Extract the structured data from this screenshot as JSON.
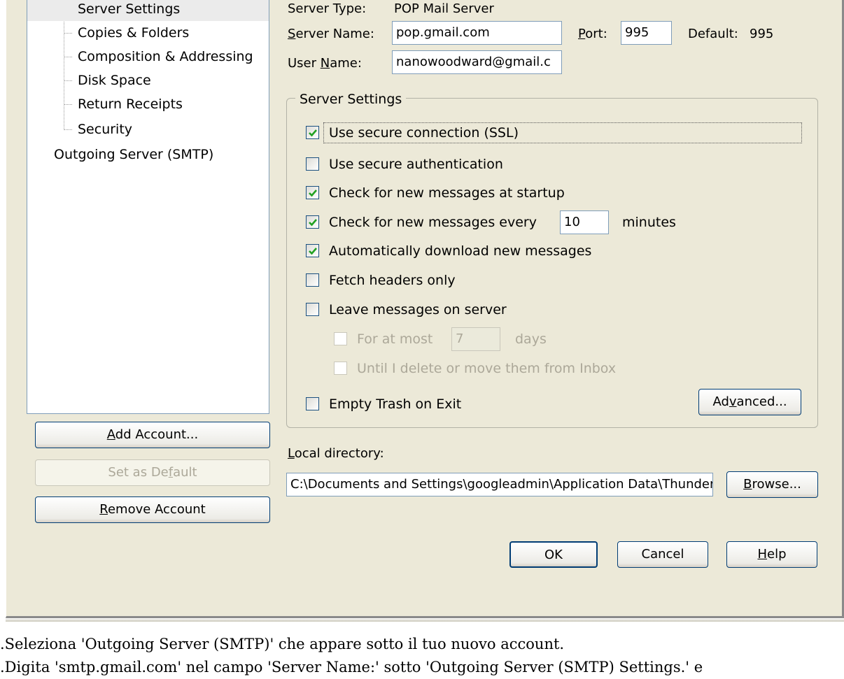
{
  "tree": {
    "items": [
      {
        "label": "Server Settings",
        "selected": true
      },
      {
        "label": "Copies & Folders",
        "selected": false
      },
      {
        "label": "Composition & Addressing",
        "selected": false
      },
      {
        "label": "Disk Space",
        "selected": false
      },
      {
        "label": "Return Receipts",
        "selected": false
      },
      {
        "label": "Security",
        "selected": false
      }
    ],
    "outgoing_label": "Outgoing Server (SMTP)"
  },
  "left_buttons": {
    "add_account": "Add Account...",
    "set_default": "Set as Default",
    "remove_account": "Remove Account"
  },
  "server": {
    "type_label": "Server Type:",
    "type_value": "POP Mail Server",
    "name_label": "Server Name:",
    "name_value": "pop.gmail.com",
    "port_label": "Port:",
    "port_value": "995",
    "default_label": "Default:",
    "default_value": "995",
    "user_label": "User Name:",
    "user_value": "nanowoodward@gmail.c"
  },
  "settings_group": {
    "title": "Server Settings",
    "use_ssl": {
      "label": "Use secure connection (SSL)",
      "checked": true
    },
    "secure_auth": {
      "label": "Use secure authentication",
      "checked": false
    },
    "check_startup": {
      "label": "Check for new messages at startup",
      "checked": true
    },
    "check_every": {
      "label": "Check for new messages every",
      "checked": true,
      "value": "10",
      "unit": "minutes"
    },
    "auto_download": {
      "label": "Automatically download new messages",
      "checked": true
    },
    "headers_only": {
      "label": "Fetch headers only",
      "checked": false
    },
    "leave_on_server": {
      "label": "Leave messages on server",
      "checked": false
    },
    "for_at_most": {
      "label": "For at most",
      "checked": false,
      "value": "7",
      "unit": "days"
    },
    "until_delete": {
      "label": "Until I delete or move them from Inbox",
      "checked": false
    },
    "empty_trash": {
      "label": "Empty Trash on Exit",
      "checked": false
    },
    "advanced_button": "Advanced..."
  },
  "local_dir": {
    "label": "Local directory:",
    "value": "C:\\Documents and Settings\\googleadmin\\Application Data\\Thunderbird",
    "browse_button": "Browse..."
  },
  "footer": {
    "ok": "OK",
    "cancel": "Cancel",
    "help": "Help"
  },
  "instructions": {
    "line1": ".Seleziona 'Outgoing Server (SMTP)' che appare sotto il tuo nuovo account.",
    "line2": ".Digita 'smtp.gmail.com' nel campo 'Server Name:' sotto 'Outgoing Server (SMTP) Settings.' e"
  },
  "colors": {
    "dialog_bg": "#ece9d8",
    "check_green": "#21a121",
    "input_border": "#7f9db9",
    "button_border": "#003c74"
  }
}
